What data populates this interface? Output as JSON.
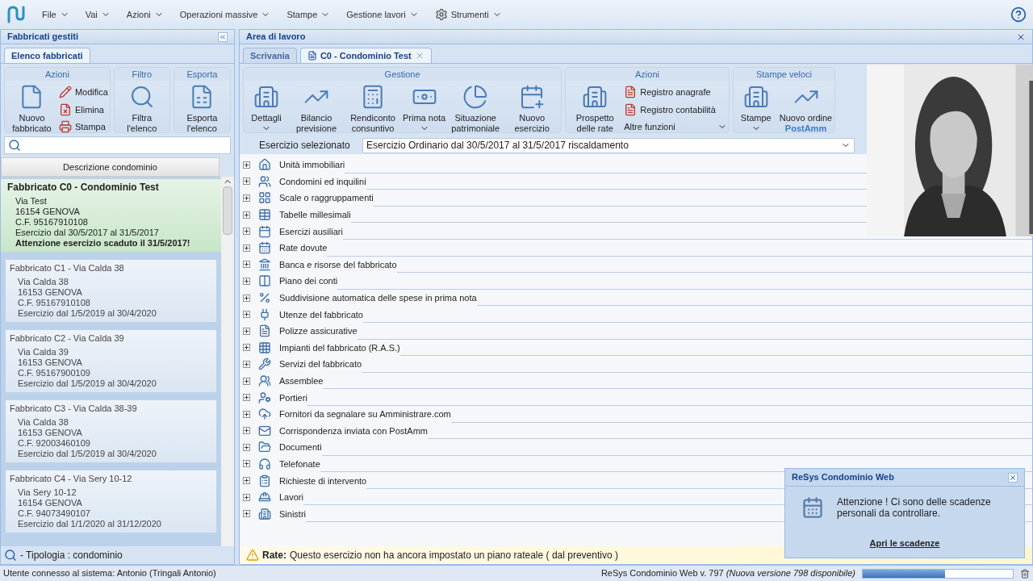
{
  "menu": [
    {
      "label": "File"
    },
    {
      "label": "Vai"
    },
    {
      "label": "Azioni"
    },
    {
      "label": "Operazioni massive"
    },
    {
      "label": "Stampe"
    },
    {
      "label": "Gestione lavori"
    },
    {
      "label": "Strumenti",
      "kind": "gear"
    }
  ],
  "left_panel": {
    "title": "Fabbricati gestiti",
    "tabs": [
      {
        "label": "Elenco fabbricati",
        "selected": true
      }
    ],
    "ribbon": [
      {
        "title": "Azioni",
        "large": [
          {
            "label": "Nuovo fabbricato"
          }
        ],
        "small": [
          {
            "label": "Modifica"
          },
          {
            "label": "Elimina"
          },
          {
            "label": "Stampa"
          }
        ]
      },
      {
        "title": "Filtro",
        "large": [
          {
            "label": "Filtra l'elenco"
          }
        ]
      },
      {
        "title": "Esporta",
        "large": [
          {
            "label": "Esporta l'elenco"
          }
        ]
      }
    ],
    "column": "Descrizione condominio",
    "buildings": [
      {
        "title": "Fabbricato C0 - Condominio Test",
        "lines": [
          "Via Test",
          "16154 GENOVA",
          "C.F. 95167910108",
          "Esercizio dal 30/5/2017 al 31/5/2017"
        ],
        "warning": "Attenzione esercizio scaduto il 31/5/2017!",
        "selected": true
      },
      {
        "title": "Fabbricato C1 - Via Calda 38",
        "lines": [
          "Via Calda 38",
          "16153 GENOVA",
          "C.F. 95167910108",
          "Esercizio dal 1/5/2019 al 30/4/2020"
        ],
        "selected": false
      },
      {
        "title": "Fabbricato C2 - Via Calda 39",
        "lines": [
          "Via Calda 39",
          "16153 GENOVA",
          "C.F. 95167900109",
          "Esercizio dal 1/5/2019 al 30/4/2020"
        ],
        "selected": false
      },
      {
        "title": "Fabbricato C3 - Via Calda 38-39",
        "lines": [
          "Via Calda 38",
          "16153 GENOVA",
          "C.F. 92003460109",
          "Esercizio dal 1/5/2019 al 30/4/2020"
        ],
        "selected": false
      },
      {
        "title": "Fabbricato C4 - Via Sery 10-12",
        "lines": [
          "Via Sery 10-12",
          "16154 GENOVA",
          "C.F. 94073490107",
          "Esercizio dal 1/1/2020 al 31/12/2020"
        ],
        "selected": false
      }
    ],
    "filter": "- Tipologia : condominio"
  },
  "work_area": {
    "title": "Area di lavoro",
    "tabs": [
      {
        "label": "Scrivania",
        "selected": false
      },
      {
        "label": "C0 - Condominio Test",
        "selected": true,
        "closable": true
      }
    ],
    "ribbon": [
      {
        "title": "Gestione",
        "large": [
          {
            "label": "Dettagli",
            "dropdown": true
          },
          {
            "label": "Bilancio previsione"
          },
          {
            "label": "Rendiconto consuntivo"
          },
          {
            "label": "Prima nota",
            "dropdown": true
          },
          {
            "label": "Situazione patrimoniale"
          },
          {
            "label": "Nuovo esercizio"
          }
        ]
      },
      {
        "title": "Azioni",
        "large": [
          {
            "label": "Prospetto delle rate"
          }
        ],
        "small": [
          {
            "label": "Registro anagrafe"
          },
          {
            "label": "Registro contabilità"
          },
          {
            "label": "Altre funzioni",
            "dropdown": true
          }
        ]
      },
      {
        "title": "Stampe veloci",
        "large": [
          {
            "label": "Stampe",
            "dropdown": true
          },
          {
            "label": "Nuovo ordine",
            "sublabel": "PostAmm"
          }
        ]
      }
    ],
    "exercise_label": "Esercizio selezionato",
    "exercise_value": "Esercizio Ordinario dal 30/5/2017 al 31/5/2017 riscaldamento",
    "tree": [
      {
        "label": "Unità immobiliari",
        "expanded": false
      },
      {
        "label": "Condomini ed inquilini",
        "expanded": false
      },
      {
        "label": "Scale o raggruppamenti",
        "expanded": false
      },
      {
        "label": "Tabelle millesimali",
        "expanded": false
      },
      {
        "label": "Esercizi ausiliari",
        "expanded": false
      },
      {
        "label": "Rate dovute",
        "expanded": false
      },
      {
        "label": "Banca e risorse del fabbricato",
        "expanded": false
      },
      {
        "label": "Piano dei conti",
        "expanded": false
      },
      {
        "label": "Suddivisione automatica delle spese in prima nota",
        "expanded": false
      },
      {
        "label": "Utenze del fabbricato",
        "expanded": false
      },
      {
        "label": "Polizze assicurative",
        "expanded": false
      },
      {
        "label": "Impianti del fabbricato (R.A.S.)",
        "expanded": false
      },
      {
        "label": "Servizi del fabbricato",
        "expanded": false
      },
      {
        "label": "Assemblee",
        "expanded": false
      },
      {
        "label": "Portieri",
        "expanded": false
      },
      {
        "label": "Fornitori da segnalare su Amministrare.com",
        "expanded": false
      },
      {
        "label": "Corrispondenza inviata con PostAmm",
        "expanded": false
      },
      {
        "label": "Documenti",
        "expanded": false
      },
      {
        "label": "Telefonate",
        "expanded": false
      },
      {
        "label": "Richieste di intervento",
        "expanded": false
      },
      {
        "label": "Lavori",
        "expanded": false
      },
      {
        "label": "Sinistri",
        "expanded": false
      }
    ],
    "warning": {
      "label": "Rate:",
      "text": "Questo esercizio non ha ancora impostato un piano rateale ( dal preventivo )"
    }
  },
  "popup": {
    "title": "ReSys Condominio Web",
    "message": "Attenzione ! Ci sono delle scadenze personali da controllare.",
    "link": "Apri le scadenze"
  },
  "status_bar": {
    "user": "Utente connesso al sistema: Antonio (Tringali Antonio)",
    "version": "ReSys Condominio Web v. 797",
    "update": "(Nuova versione 798 disponibile)",
    "progress": {
      "level": 0.55
    }
  }
}
